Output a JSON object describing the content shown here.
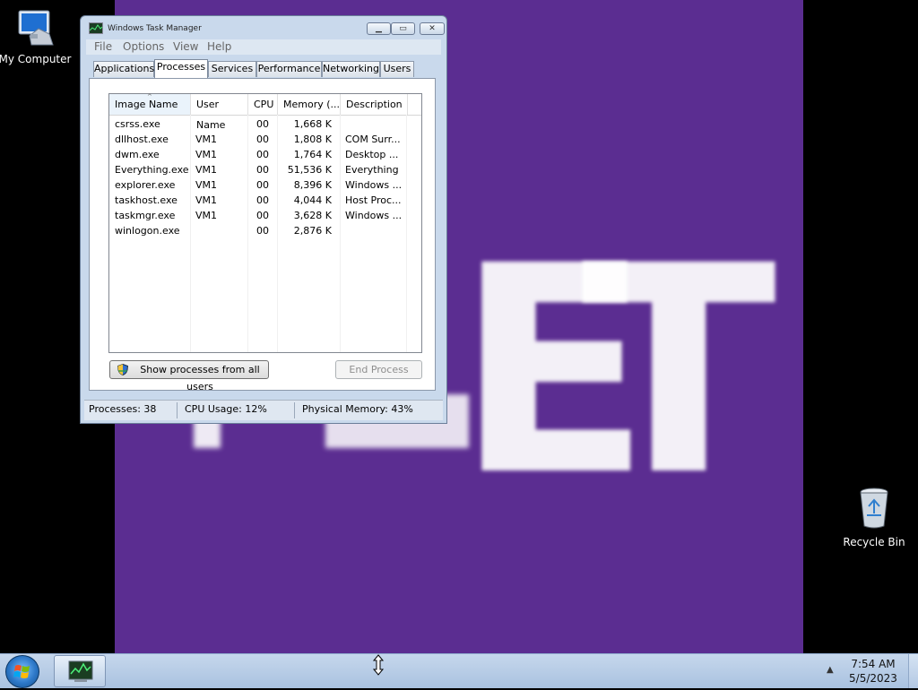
{
  "desktop": {
    "icons": [
      {
        "label": "My Computer",
        "icon": "computer-icon"
      },
      {
        "label": "Recycle Bin",
        "icon": "recycle-bin-icon"
      }
    ]
  },
  "window": {
    "title": "Windows Task Manager",
    "menu": [
      "File",
      "Options",
      "View",
      "Help"
    ],
    "tabs": [
      "Applications",
      "Processes",
      "Services",
      "Performance",
      "Networking",
      "Users"
    ],
    "active_tab": "Processes",
    "columns": [
      "Image Name",
      "User Name",
      "CPU",
      "Memory (...",
      "Description"
    ],
    "rows": [
      {
        "image": "csrss.exe",
        "user": "",
        "cpu": "00",
        "memory": "1,668 K",
        "desc": ""
      },
      {
        "image": "dllhost.exe",
        "user": "VM1",
        "cpu": "00",
        "memory": "1,808 K",
        "desc": "COM Surr..."
      },
      {
        "image": "dwm.exe",
        "user": "VM1",
        "cpu": "00",
        "memory": "1,764 K",
        "desc": "Desktop ..."
      },
      {
        "image": "Everything.exe",
        "user": "VM1",
        "cpu": "00",
        "memory": "51,536 K",
        "desc": "Everything"
      },
      {
        "image": "explorer.exe",
        "user": "VM1",
        "cpu": "00",
        "memory": "8,396 K",
        "desc": "Windows ..."
      },
      {
        "image": "taskhost.exe",
        "user": "VM1",
        "cpu": "00",
        "memory": "4,044 K",
        "desc": "Host Proc..."
      },
      {
        "image": "taskmgr.exe",
        "user": "VM1",
        "cpu": "00",
        "memory": "3,628 K",
        "desc": "Windows ..."
      },
      {
        "image": "winlogon.exe",
        "user": "",
        "cpu": "00",
        "memory": "2,876 K",
        "desc": ""
      }
    ],
    "show_all_label": "Show processes from all users",
    "end_process_label": "End Process",
    "status": {
      "processes": "Processes: 38",
      "cpu": "CPU Usage: 12%",
      "memory": "Physical Memory: 43%"
    }
  },
  "taskbar": {
    "time": "7:54 AM",
    "date": "5/5/2023"
  },
  "colors": {
    "wallpaper": "#5b2d91",
    "taskbar": "#b8cde6",
    "window_frame": "#c9d9ec"
  }
}
